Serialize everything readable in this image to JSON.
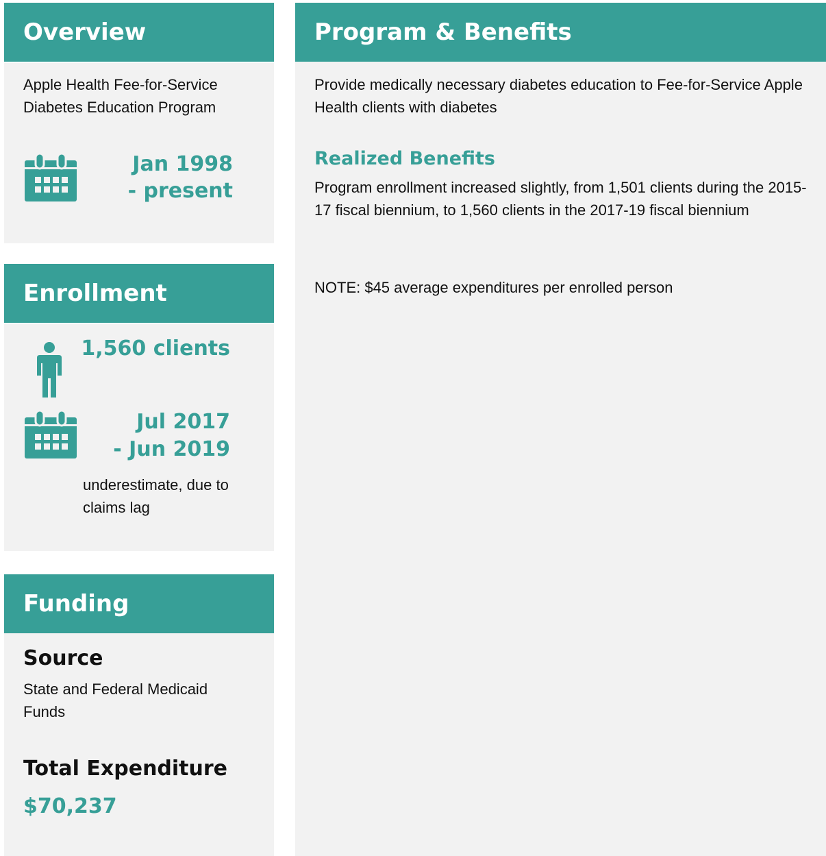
{
  "overview": {
    "title": "Overview",
    "program_name": "Apple Health Fee-for-Service Diabetes Education Program",
    "date_line1": "Jan 1998",
    "date_line2": "- present",
    "icon": "calendar-icon"
  },
  "enrollment": {
    "title": "Enrollment",
    "clients": "1,560 clients",
    "period_line1": "Jul 2017",
    "period_line2": "- Jun 2019",
    "note": "underestimate, due to claims lag",
    "icons": [
      "person-icon",
      "calendar-icon"
    ]
  },
  "funding": {
    "title": "Funding",
    "source_heading": "Source",
    "source_text": "State and Federal Medicaid Funds",
    "expenditure_heading": "Total Expenditure",
    "expenditure_value": "$70,237"
  },
  "program": {
    "title": "Program & Benefits",
    "description": "Provide medically necessary diabetes education to Fee-for-Service Apple Health clients with diabetes",
    "benefits_heading": "Realized Benefits",
    "benefits_text": "Program enrollment increased slightly, from 1,501 clients during the 2015-17 fiscal biennium, to 1,560 clients in the 2017-19 fiscal biennium",
    "note": "NOTE: $45 average expenditures per enrolled person"
  },
  "colors": {
    "accent": "#379f97",
    "panel": "#f2f2f2"
  }
}
